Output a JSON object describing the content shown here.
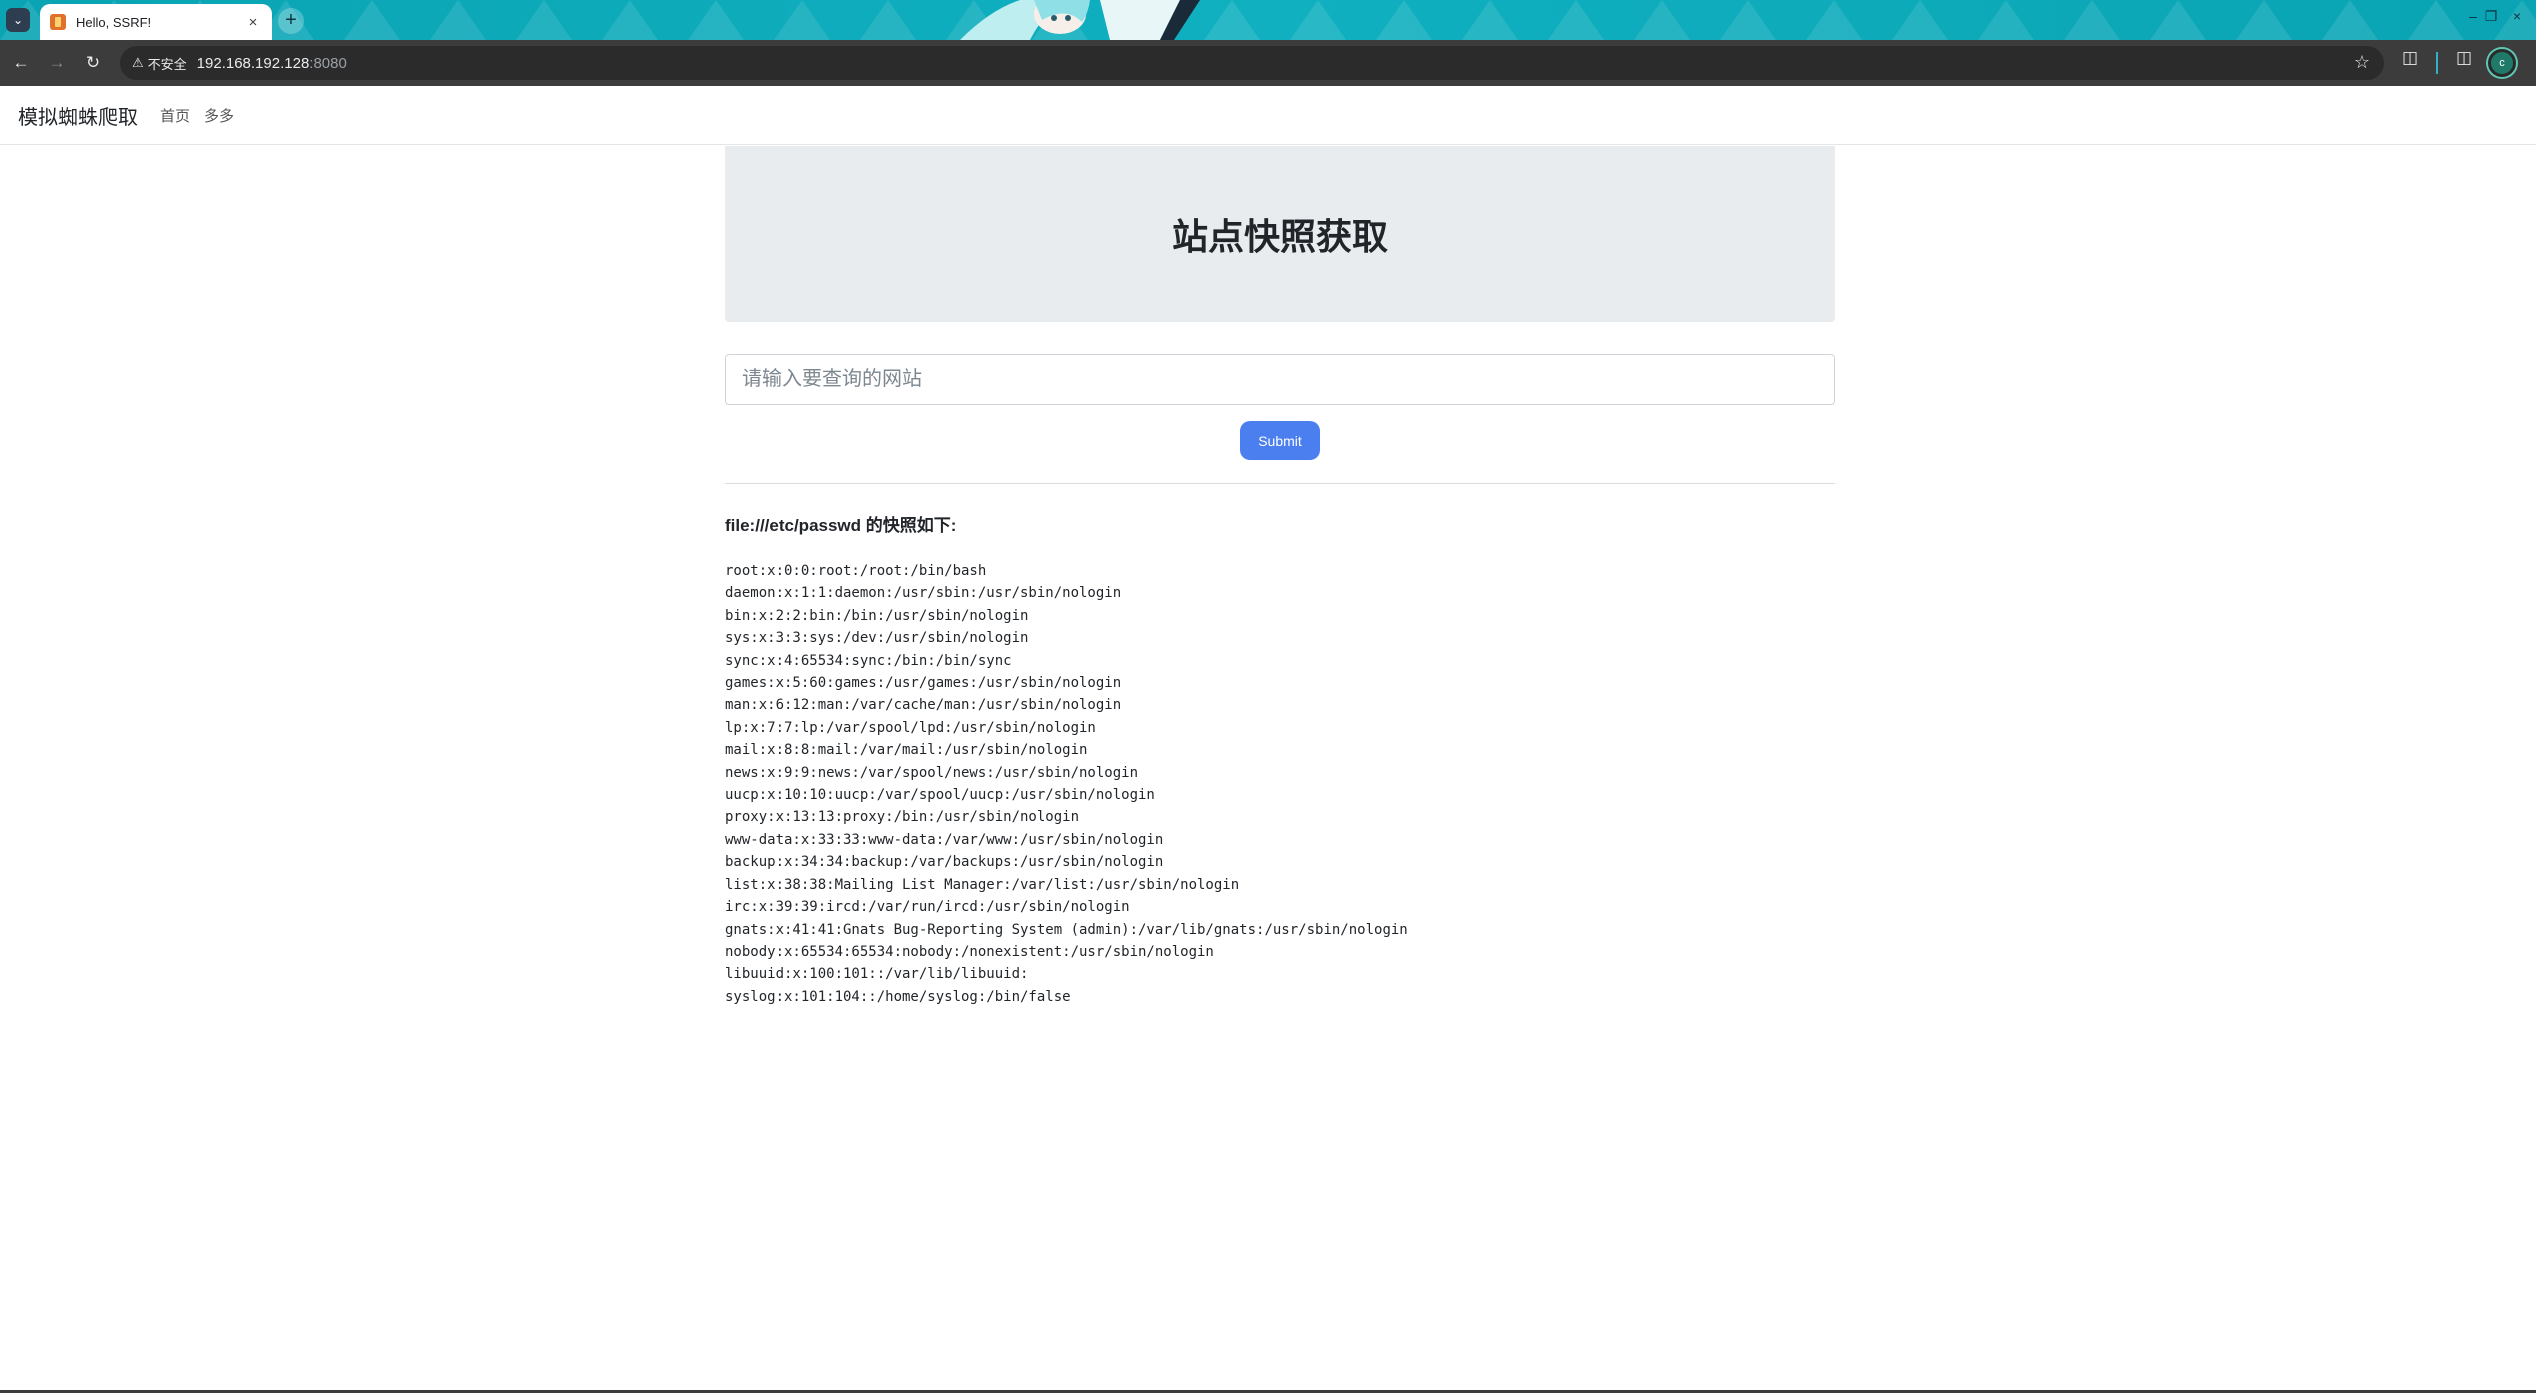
{
  "browser": {
    "tab_title": "Hello, SSRF!",
    "tab_close": "×",
    "new_tab": "+",
    "tab_search": "⌄",
    "security_label": "不安全",
    "url_host": "192.168.192.128",
    "url_port": ":8080",
    "window_controls": [
      "–",
      "❐",
      "×"
    ]
  },
  "navbar": {
    "brand": "模拟蜘蛛爬取",
    "links": [
      "首页",
      "多多"
    ]
  },
  "hero": {
    "title": "站点快照获取"
  },
  "form": {
    "placeholder": "请输入要查询的网站",
    "submit_label": "Submit"
  },
  "result": {
    "heading": "file:///etc/passwd 的快照如下:",
    "lines": [
      "root:x:0:0:root:/root:/bin/bash",
      "daemon:x:1:1:daemon:/usr/sbin:/usr/sbin/nologin",
      "bin:x:2:2:bin:/bin:/usr/sbin/nologin",
      "sys:x:3:3:sys:/dev:/usr/sbin/nologin",
      "sync:x:4:65534:sync:/bin:/bin/sync",
      "games:x:5:60:games:/usr/games:/usr/sbin/nologin",
      "man:x:6:12:man:/var/cache/man:/usr/sbin/nologin",
      "lp:x:7:7:lp:/var/spool/lpd:/usr/sbin/nologin",
      "mail:x:8:8:mail:/var/mail:/usr/sbin/nologin",
      "news:x:9:9:news:/var/spool/news:/usr/sbin/nologin",
      "uucp:x:10:10:uucp:/var/spool/uucp:/usr/sbin/nologin",
      "proxy:x:13:13:proxy:/bin:/usr/sbin/nologin",
      "www-data:x:33:33:www-data:/var/www:/usr/sbin/nologin",
      "backup:x:34:34:backup:/var/backups:/usr/sbin/nologin",
      "list:x:38:38:Mailing List Manager:/var/list:/usr/sbin/nologin",
      "irc:x:39:39:ircd:/var/run/ircd:/usr/sbin/nologin",
      "gnats:x:41:41:Gnats Bug-Reporting System (admin):/var/lib/gnats:/usr/sbin/nologin",
      "nobody:x:65534:65534:nobody:/nonexistent:/usr/sbin/nologin",
      "libuuid:x:100:101::/var/lib/libuuid:",
      "syslog:x:101:104::/home/syslog:/bin/false"
    ]
  },
  "colors": {
    "accent": "#4b7ff0",
    "hero_bg": "#e9ecef",
    "tabstrip": "#0aa4b4",
    "toolbar": "#3c3c3c"
  },
  "icons": {
    "back": "back-arrow-icon",
    "forward": "forward-arrow-icon",
    "reload": "reload-icon",
    "warning": "warning-triangle-icon",
    "star": "bookmark-star-icon",
    "extensions": "extensions-icon",
    "sidepanel": "side-panel-icon",
    "profile": "profile-avatar-icon"
  }
}
